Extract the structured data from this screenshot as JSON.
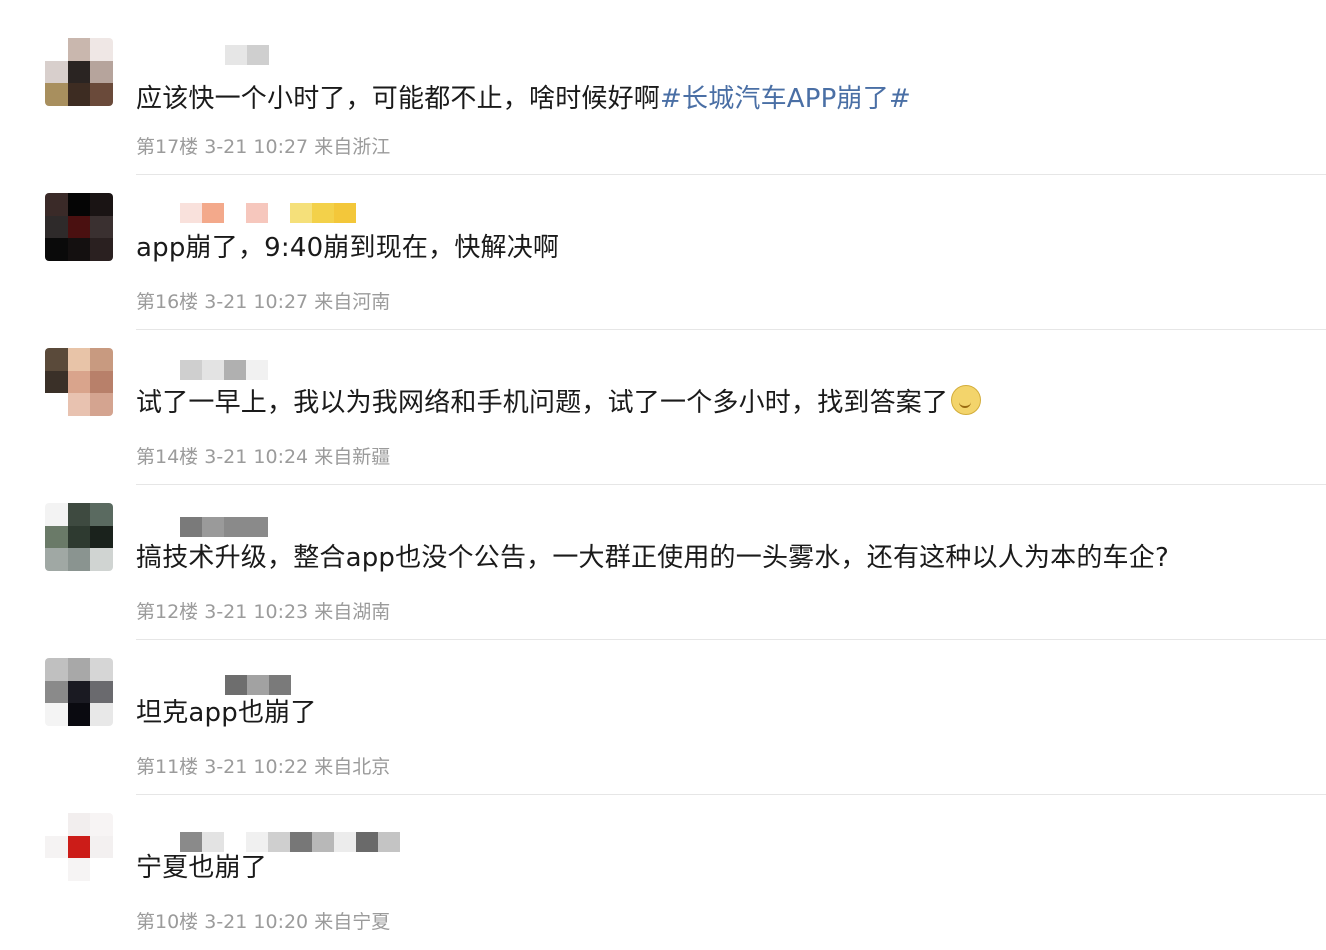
{
  "comments": [
    {
      "text": "应该快一个小时了，可能都不止，啥时候好啊",
      "topic": "#长城汽车APP崩了#",
      "floor": "第17楼",
      "time": "3-21 10:27",
      "location": "来自浙江"
    },
    {
      "text": "app崩了，9:40崩到现在，快解决啊",
      "topic": "",
      "floor": "第16楼",
      "time": "3-21 10:27",
      "location": "来自河南"
    },
    {
      "text": "试了一早上，我以为我网络和手机问题，试了一个多小时，找到答案了",
      "topic": "",
      "emoji": "smile-emoji",
      "floor": "第14楼",
      "time": "3-21 10:24",
      "location": "来自新疆"
    },
    {
      "text": "搞技术升级，整合app也没个公告，一大群正使用的一头雾水，还有这种以人为本的车企?",
      "topic": "",
      "floor": "第12楼",
      "time": "3-21 10:23",
      "location": "来自湖南"
    },
    {
      "text": "坦克app也崩了",
      "topic": "",
      "floor": "第11楼",
      "time": "3-21 10:22",
      "location": "来自北京"
    },
    {
      "text": "宁夏也崩了",
      "topic": "",
      "floor": "第10楼",
      "time": "3-21 10:20",
      "location": "来自宁夏"
    }
  ],
  "colors": {
    "topic": "#4a6fa5",
    "meta": "#9b9b9b",
    "text": "#1a1a1a"
  }
}
